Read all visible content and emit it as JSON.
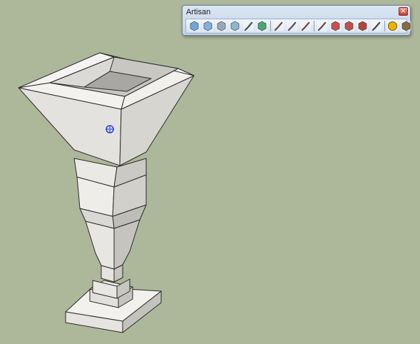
{
  "toolbar": {
    "title": "Artisan",
    "close_glyph": "×",
    "groups": [
      {
        "tools": [
          {
            "icon": "subdivide-smooth-icon",
            "color": "#6fa8d8"
          },
          {
            "icon": "smooth-icon",
            "color": "#7fb2dc"
          },
          {
            "icon": "subdivide-icon",
            "color": "#9aa9b8"
          },
          {
            "icon": "crease-icon",
            "color": "#8fb6d0"
          },
          {
            "icon": "knife-icon",
            "color": "#3c6f3a"
          },
          {
            "icon": "vertex-tools-icon",
            "color": "#4aa86a"
          }
        ]
      },
      {
        "tools": [
          {
            "icon": "sculpt-brush-icon",
            "color": "#c0483e"
          },
          {
            "icon": "sculpt-brush-2-icon",
            "color": "#9a4fa8"
          },
          {
            "icon": "sculpt-brush-3-icon",
            "color": "#c2503c"
          }
        ]
      },
      {
        "tools": [
          {
            "icon": "select-by-brush-icon",
            "color": "#c04a44"
          },
          {
            "icon": "soft-select-icon",
            "color": "#c9504a"
          },
          {
            "icon": "magnet-icon",
            "color": "#c44e48"
          },
          {
            "icon": "paint-select-icon",
            "color": "#b8443c"
          },
          {
            "icon": "brush-icon",
            "color": "#444444"
          }
        ]
      },
      {
        "tools": [
          {
            "icon": "info-icon",
            "color": "#e8b400"
          },
          {
            "icon": "settings-tools-icon",
            "color": "#8a6a3a"
          }
        ]
      }
    ]
  },
  "canvas": {
    "background": "#adb79a",
    "model_face_light": "#e9e7e3",
    "model_face_mid": "#d3d1cd",
    "model_face_dark": "#b5b3af",
    "edge_color": "#2a2a2a"
  }
}
